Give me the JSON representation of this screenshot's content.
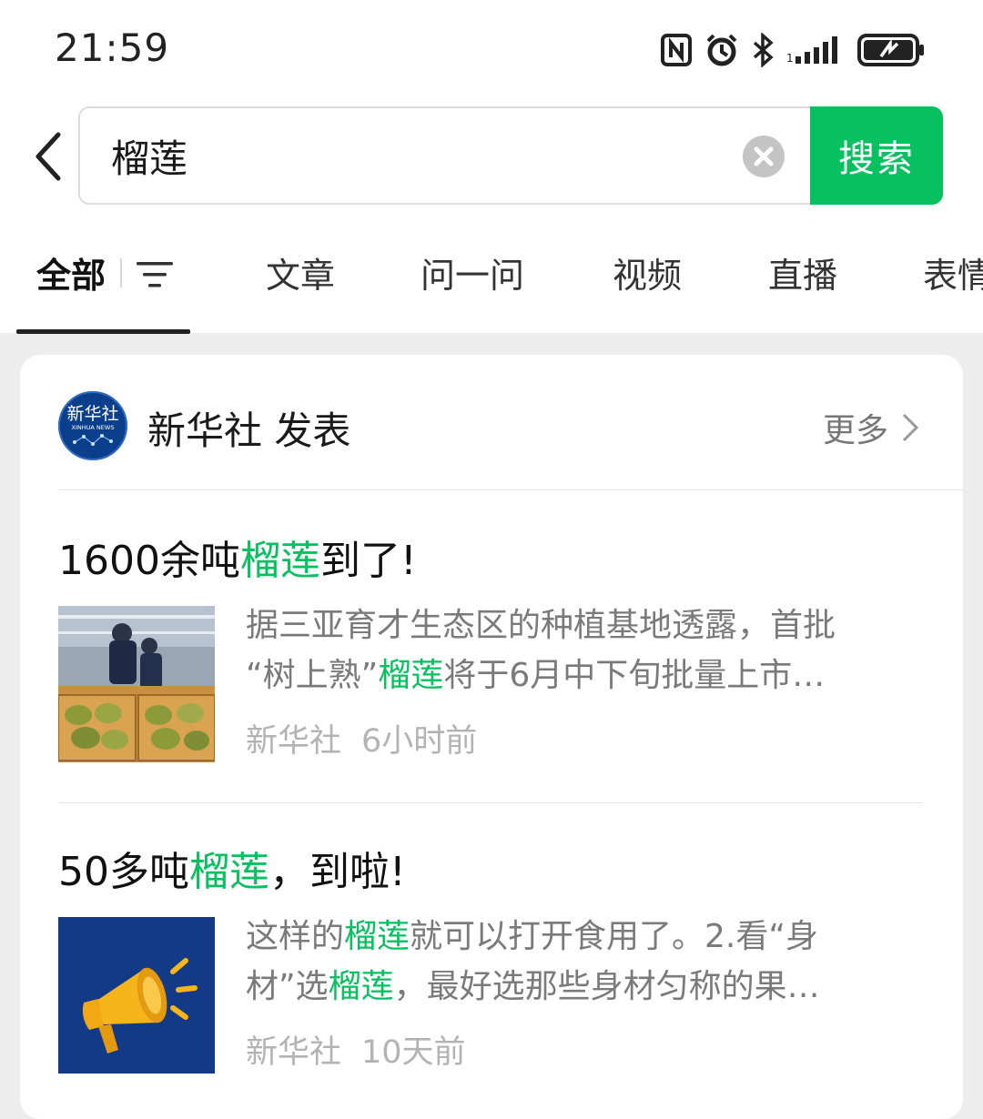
{
  "status_bar": {
    "time": "21:59",
    "icons": [
      "nfc-icon",
      "alarm-icon",
      "bluetooth-icon",
      "signal-icon",
      "battery-charging-icon"
    ]
  },
  "search": {
    "query": "榴莲",
    "button_label": "搜索"
  },
  "tabs": {
    "items": [
      {
        "label": "全部",
        "active": true
      },
      {
        "label": "文章"
      },
      {
        "label": "问一问"
      },
      {
        "label": "视频"
      },
      {
        "label": "直播"
      },
      {
        "label": "表情"
      }
    ]
  },
  "publisher": {
    "name": "新华社 发表",
    "logo_text": "新华社",
    "logo_subtext": "XINHUA NEWS",
    "more_label": "更多"
  },
  "results": [
    {
      "title_pre": "1600余吨",
      "title_hl": "榴莲",
      "title_post": "到了!",
      "snippet_line1_pre": "据三亚育才生态区的种植基地透露，首批",
      "snippet_line2_pre": "“树上熟”",
      "snippet_line2_hl": "榴莲",
      "snippet_line2_post": "将于6月中下旬批量上市…",
      "source": "新华社",
      "time": "6小时前"
    },
    {
      "title_pre": "50多吨",
      "title_hl": "榴莲",
      "title_post": "，到啦!",
      "snippet_line1_pre": "这样的",
      "snippet_line1_hl": "榴莲",
      "snippet_line1_post": "就可以打开食用了。2.看“身",
      "snippet_line2_pre": "材”选",
      "snippet_line2_hl": "榴莲",
      "snippet_line2_post": "，最好选那些身材匀称的果…",
      "source": "新华社",
      "time": "10天前"
    }
  ],
  "colors": {
    "accent": "#07c160",
    "xinhua_blue": "#0b3f8c",
    "thumb_navy": "#123a86",
    "megaphone": "#f6b51a"
  }
}
